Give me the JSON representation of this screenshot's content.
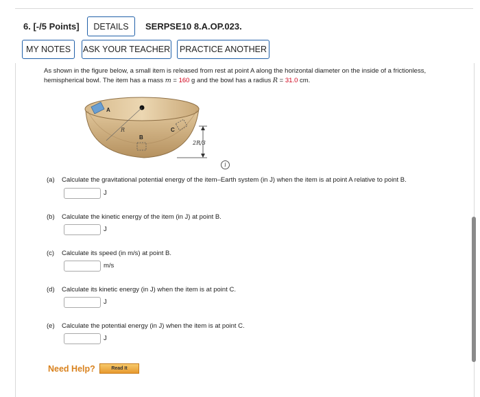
{
  "header": {
    "question_number": "6. [-/5 Points]",
    "details_label": "DETAILS",
    "problem_code": "SERPSE10 8.A.OP.023."
  },
  "toolbar": {
    "my_notes_label": "MY NOTES",
    "ask_teacher_label": "ASK YOUR TEACHER",
    "practice_another_label": "PRACTICE ANOTHER"
  },
  "problem": {
    "text_part1": "As shown in the figure below, a small item is released from rest at point A along the horizontal diameter on the inside of a frictionless, hemispherical bowl. The item has a mass ",
    "mass_symbol": "m",
    "text_part2": " = ",
    "mass_value": "160",
    "text_part3": " g and the bowl has a radius ",
    "radius_symbol": "R",
    "text_part4": " = ",
    "radius_value": "31.0",
    "text_part5": " cm."
  },
  "figure": {
    "label_A": "A",
    "label_B": "B",
    "label_C": "C",
    "label_R": "R",
    "label_height": "2R/3"
  },
  "parts": [
    {
      "label": "(a)",
      "question": "Calculate the gravitational potential energy of the item–Earth system (in J) when the item is at point A relative to point B.",
      "unit": "J",
      "value": ""
    },
    {
      "label": "(b)",
      "question": "Calculate the kinetic energy of the item (in J) at point B.",
      "unit": "J",
      "value": ""
    },
    {
      "label": "(c)",
      "question": "Calculate its speed (in m/s) at point B.",
      "unit": "m/s",
      "value": ""
    },
    {
      "label": "(d)",
      "question": "Calculate its kinetic energy (in J) when the item is at point C.",
      "unit": "J",
      "value": ""
    },
    {
      "label": "(e)",
      "question": "Calculate the potential energy (in J) when the item is at point C.",
      "unit": "J",
      "value": ""
    }
  ],
  "help": {
    "need_help_label": "Need Help?",
    "read_it_label": "Read It"
  },
  "colors": {
    "button_border": "#1f5fa8",
    "highlight_value": "#d0021b",
    "need_help": "#d9821e"
  }
}
